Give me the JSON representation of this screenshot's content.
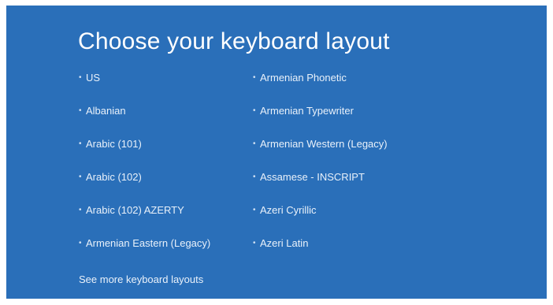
{
  "page": {
    "title": "Choose your keyboard layout",
    "background_color": "#2a6fb9"
  },
  "layouts": {
    "left": [
      {
        "label": "US"
      },
      {
        "label": "Albanian"
      },
      {
        "label": "Arabic (101)"
      },
      {
        "label": "Arabic (102)"
      },
      {
        "label": "Arabic (102) AZERTY"
      },
      {
        "label": "Armenian Eastern (Legacy)"
      }
    ],
    "right": [
      {
        "label": "Armenian Phonetic"
      },
      {
        "label": "Armenian Typewriter"
      },
      {
        "label": "Armenian Western (Legacy)"
      },
      {
        "label": "Assamese - INSCRIPT"
      },
      {
        "label": "Azeri Cyrillic"
      },
      {
        "label": "Azeri Latin"
      }
    ]
  },
  "footer": {
    "more_link": "See more keyboard layouts"
  }
}
